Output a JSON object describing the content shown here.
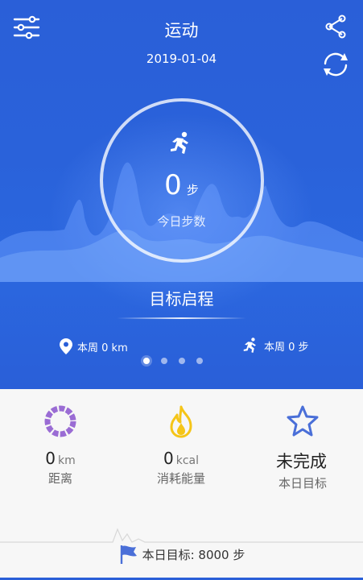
{
  "header": {
    "title": "运动",
    "date": "2019-01-04"
  },
  "steps": {
    "value": "0",
    "unit": "步",
    "label": "今日步数"
  },
  "goal": {
    "title": "目标启程"
  },
  "week": {
    "distance": "本周 0 km",
    "steps": "本周 0 步"
  },
  "pager": {
    "count": 4,
    "active_index": 0
  },
  "stats": [
    {
      "value": "0",
      "unit": "km",
      "label": "距离",
      "icon": "ring-icon"
    },
    {
      "value": "0",
      "unit": "kcal",
      "label": "消耗能量",
      "icon": "flame-icon"
    },
    {
      "value": "未完成",
      "unit": "",
      "label": "本日目标",
      "icon": "star-icon"
    }
  ],
  "daily_goal": "本日目标: 8000 步",
  "colors": {
    "primary": "#2a5fd8",
    "ring_purple": "#9a6cd4",
    "flame_yellow": "#f5c518",
    "star_blue": "#4a6fd8"
  },
  "icons": [
    "menu-sliders-icon",
    "share-icon",
    "sync-icon",
    "runner-icon",
    "location-pin-icon",
    "flag-icon"
  ]
}
